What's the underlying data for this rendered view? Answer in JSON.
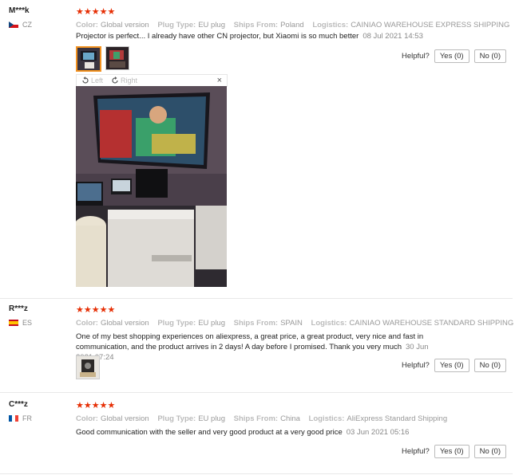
{
  "reviews": [
    {
      "user": "M***k",
      "country": "CZ",
      "stars": "★★★★★",
      "color_label": "Color:",
      "color_value": "Global version",
      "plug_label": "Plug Type:",
      "plug_value": "EU plug",
      "ships_label": "Ships From:",
      "ships_value": "Poland",
      "logistics_label": "Logistics:",
      "logistics_value": "CAINIAO WAREHOUSE EXPRESS SHIPPING",
      "text": "Projector is perfect... I already have other CN projector, but Xiaomi is so much better",
      "date": "08 Jul 2021 14:53",
      "helpful_label": "Helpful?",
      "yes_label": "Yes (0)",
      "no_label": "No (0)"
    },
    {
      "user": "R***z",
      "country": "ES",
      "stars": "★★★★★",
      "color_label": "Color:",
      "color_value": "Global version",
      "plug_label": "Plug Type:",
      "plug_value": "EU plug",
      "ships_label": "Ships From:",
      "ships_value": "SPAIN",
      "logistics_label": "Logistics:",
      "logistics_value": "CAINIAO WAREHOUSE STANDARD SHIPPING",
      "text": "One of my best shopping experiences on aliexpress, a great price, a great product, very nice and fast in communication, and the product arrives in 2 days! A day before I promised. Thank you very much",
      "date": "30 Jun 2021 07:24",
      "helpful_label": "Helpful?",
      "yes_label": "Yes (0)",
      "no_label": "No (0)"
    },
    {
      "user": "C***z",
      "country": "FR",
      "stars": "★★★★★",
      "color_label": "Color:",
      "color_value": "Global version",
      "plug_label": "Plug Type:",
      "plug_value": "EU plug",
      "ships_label": "Ships From:",
      "ships_value": "China",
      "logistics_label": "Logistics:",
      "logistics_value": "AliExpress Standard Shipping",
      "text": "Good communication with the seller and very good product at a very good price",
      "date": "03 Jun 2021 05:16",
      "helpful_label": "Helpful?",
      "yes_label": "Yes (0)",
      "no_label": "No (0)"
    }
  ],
  "viewer": {
    "left_label": "Left",
    "right_label": "Right",
    "close_glyph": "×"
  },
  "colors": {
    "star": "#e62e04",
    "selected_border": "#f29221"
  }
}
